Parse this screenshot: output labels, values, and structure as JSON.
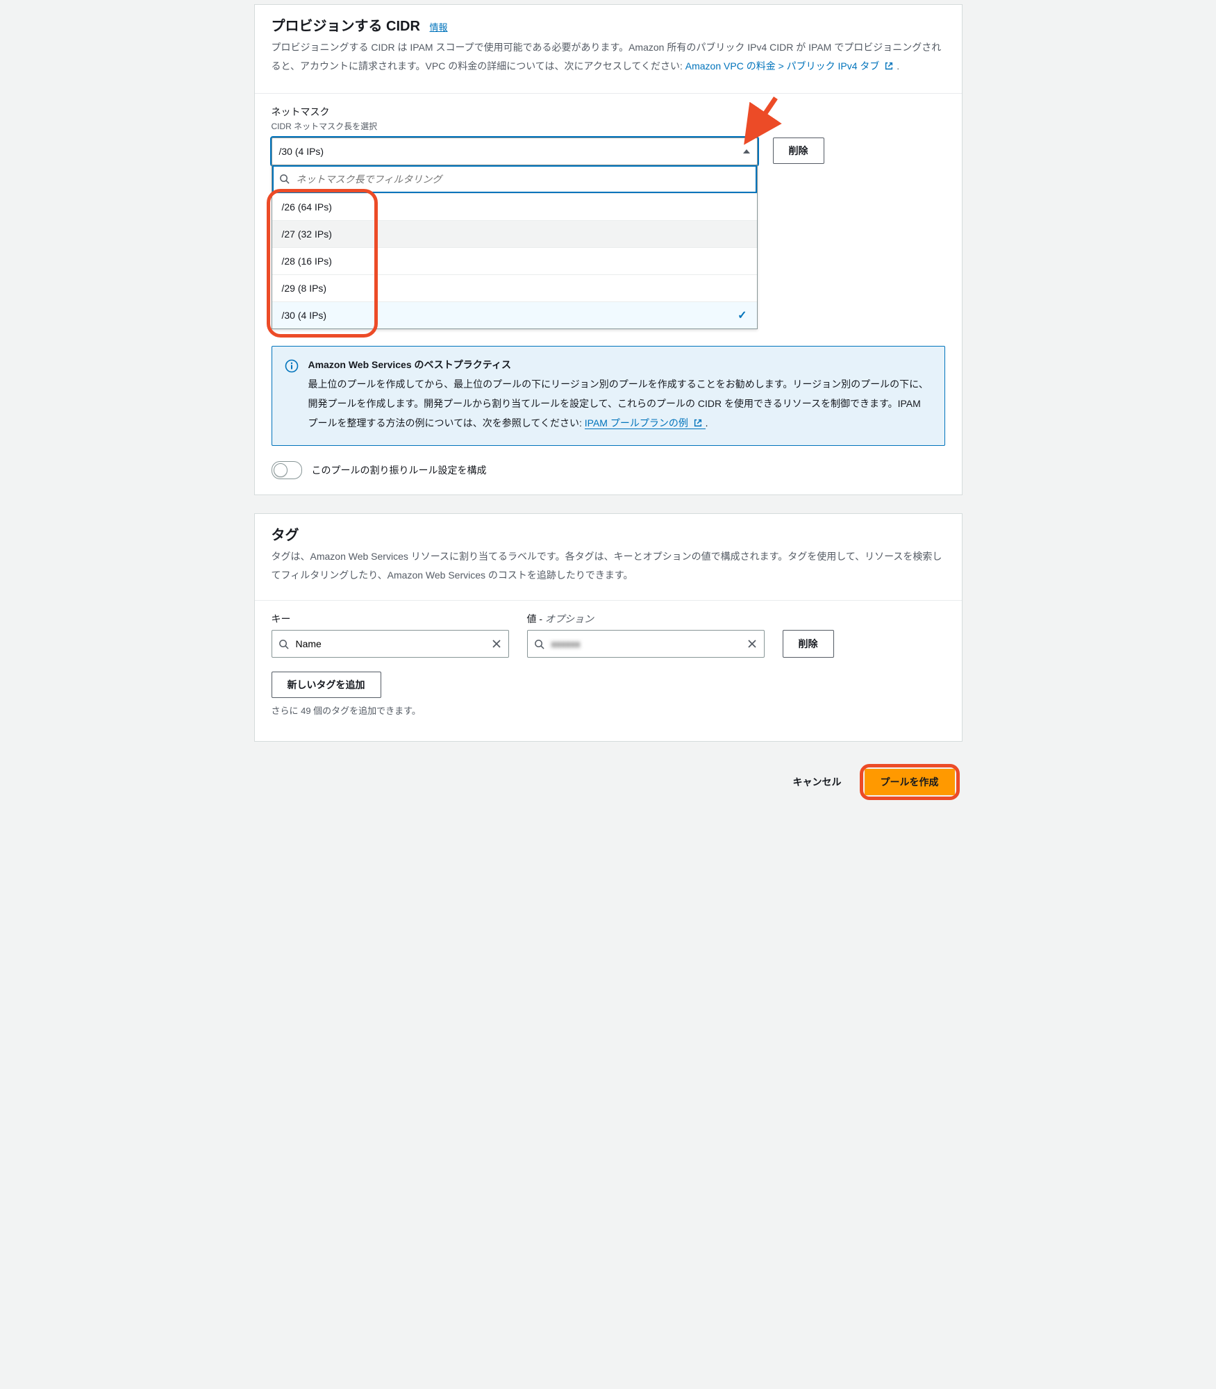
{
  "cidr": {
    "heading": "プロビジョンする CIDR",
    "info_label": "情報",
    "description_pre": "プロビジョニングする CIDR は IPAM スコープで使用可能である必要があります。Amazon 所有のパブリック IPv4 CIDR が IPAM でプロビジョニングされると、アカウントに請求されます。VPC の料金の詳細については、次にアクセスしてください: ",
    "link_text": "Amazon VPC の料金 > パブリック IPv4 タブ",
    "description_post": ".",
    "netmask_label": "ネットマスク",
    "netmask_sub": "CIDR ネットマスク長を選択",
    "selected": "/30 (4 IPs)",
    "filter_placeholder": "ネットマスク長でフィルタリング",
    "options": [
      "/26 (64 IPs)",
      "/27 (32 IPs)",
      "/28 (16 IPs)",
      "/29 (8 IPs)",
      "/30 (4 IPs)"
    ],
    "selected_index": 4,
    "hover_index": 1,
    "delete_netmask": "削除",
    "best_practice_title": "Amazon Web Services のベストプラクティス",
    "best_practice_text_pre": "最上位のプールを作成してから、最上位のプールの下にリージョン別のプールを作成することをお勧めします。リージョン別のプールの下に、開発プールを作成します。開発プールから割り当てルールを設定して、これらのプールの CIDR を使用できるリソースを制御できます。IPAM プールを整理する方法の例については、次を参照してください: ",
    "best_practice_link": "IPAM プールプランの例",
    "best_practice_text_post": ".",
    "toggle_label": "このプールの割り振りルール設定を構成"
  },
  "tags": {
    "heading": "タグ",
    "description": "タグは、Amazon Web Services リソースに割り当てるラベルです。各タグは、キーとオプションの値で構成されます。タグを使用して、リソースを検索してフィルタリングしたり、Amazon Web Services のコストを追跡したりできます。",
    "key_label": "キー",
    "value_label_pre": "値 - ",
    "value_label_opt": "オプション",
    "key_value": "Name",
    "value_value": "xxxxxx",
    "delete_tag": "削除",
    "add_tag": "新しいタグを追加",
    "remaining_hint": "さらに 49 個のタグを追加できます。"
  },
  "footer": {
    "cancel": "キャンセル",
    "create": "プールを作成"
  }
}
